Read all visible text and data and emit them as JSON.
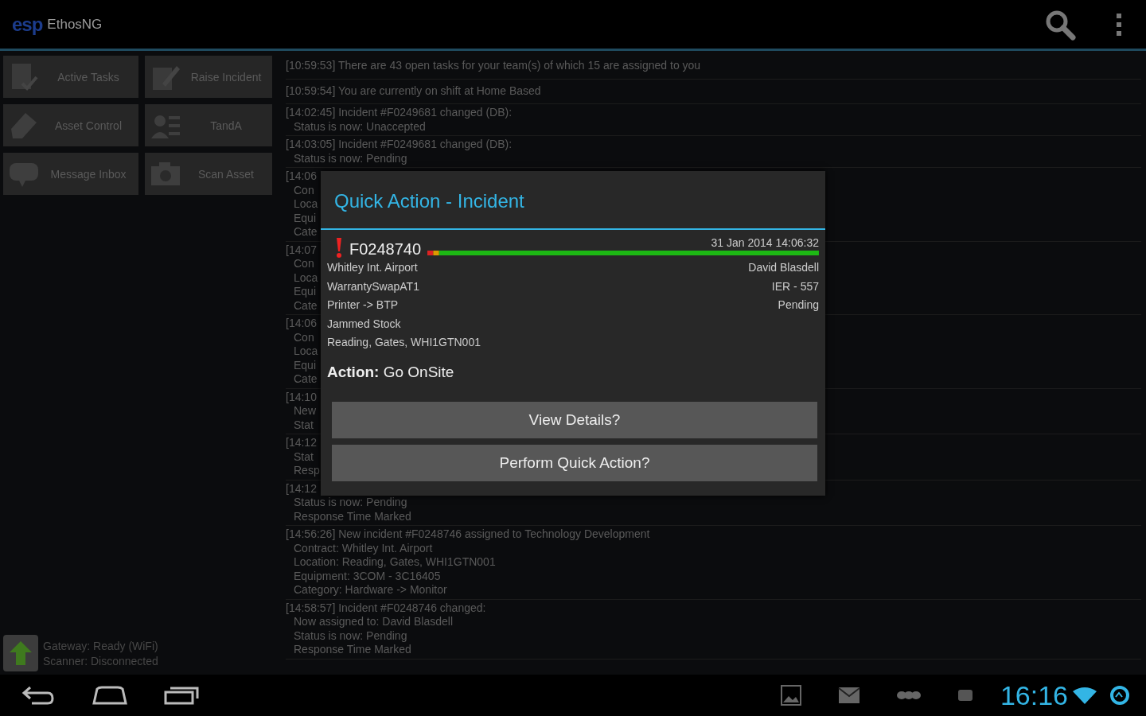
{
  "app_bar": {
    "logo": "esp",
    "title": "EthosNG"
  },
  "tiles": [
    {
      "label": "Active Tasks",
      "kind": "tasks"
    },
    {
      "label": "Raise Incident",
      "kind": "raise"
    },
    {
      "label": "Asset Control",
      "kind": "asset"
    },
    {
      "label": "TandA",
      "kind": "person"
    },
    {
      "label": "Message Inbox",
      "kind": "message"
    },
    {
      "label": "Scan Asset",
      "kind": "camera"
    }
  ],
  "status": [
    {
      "label": "Gateway:",
      "value": "Ready (WiFi)"
    },
    {
      "label": "Scanner:",
      "value": "Disconnected"
    }
  ],
  "log": [
    {
      "lines": [
        "[10:59:53] There are 43 open tasks for your team(s) of which 15 are assigned to you"
      ]
    },
    {
      "lines": [
        "[10:59:54] You are currently on shift at Home Based"
      ]
    },
    {
      "lines": [
        "[14:02:45] Incident #F0249681 changed (DB):",
        "Status is now: Unaccepted"
      ]
    },
    {
      "lines": [
        "[14:03:05] Incident #F0249681 changed (DB):",
        "Status is now: Pending"
      ]
    },
    {
      "lines": [
        "[14:06",
        "Con",
        "Loca",
        "Equi",
        "Cate"
      ]
    },
    {
      "lines": [
        "[14:07",
        "Con",
        "Loca",
        "Equi",
        "Cate"
      ]
    },
    {
      "lines": [
        "[14:06",
        "Con",
        "Loca",
        "Equi",
        "Cate"
      ]
    },
    {
      "lines": [
        "[14:10",
        "New",
        "Stat"
      ]
    },
    {
      "lines": [
        "[14:12",
        "Stat",
        "Resp"
      ]
    },
    {
      "lines": [
        "[14:12",
        "Status is now: Pending",
        "Response Time Marked"
      ]
    },
    {
      "lines": [
        "[14:56:26] New incident #F0248746 assigned to Technology Development",
        "Contract: Whitley Int. Airport",
        "Location: Reading, Gates, WHI1GTN001",
        "Equipment: 3COM - 3C16405",
        "Category: Hardware -> Monitor"
      ]
    },
    {
      "lines": [
        "[14:58:57] Incident #F0248746 changed:",
        "Now assigned to: David Blasdell",
        "Status is now: Pending",
        "Response Time Marked"
      ]
    }
  ],
  "dialog": {
    "title": "Quick Action - Incident",
    "incident": "F0248740",
    "date": "31 Jan 2014 14:06:32",
    "left": [
      "Whitley Int. Airport",
      "WarrantySwapAT1",
      "Printer -> BTP",
      "Jammed Stock",
      "Reading, Gates, WHI1GTN001"
    ],
    "right": [
      "David Blasdell",
      "IER - 557",
      "Pending"
    ],
    "action": "**Action:** Go OnSite",
    "buttons": [
      "View Details?",
      "Perform Quick Action?"
    ]
  },
  "system_bar": {
    "time": "16:16"
  }
}
